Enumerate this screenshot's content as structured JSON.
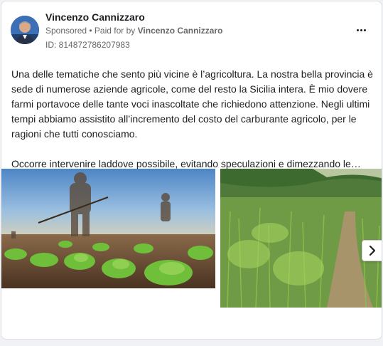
{
  "post": {
    "author": "Vincenzo Cannizzaro",
    "sponsored": "Sponsored",
    "separator": " • ",
    "paid_for_prefix": "Paid for by ",
    "paid_for_name": "Vincenzo Cannizzaro",
    "ad_id": "ID: 814872786207983",
    "paragraphs": [
      "Una delle tematiche che sento più vicine è l’agricoltura. La nostra bella provincia è sede di numerose aziende agricole, come del resto la Sicilia intera. È mio dovere farmi portavoce delle tante voci inascoltate che richiedono attenzione. Negli ultimi tempi abbiamo assistito all’incremento del costo del carburante agricolo, per le ragioni che tutti conosciamo.",
      "Occorre intervenire laddove possibile, evitando speculazioni e dimezzando le…"
    ]
  },
  "icons": {
    "more": "more-options-icon",
    "next": "chevron-right-icon"
  },
  "colors": {
    "text_primary": "#1c1e21",
    "text_secondary": "#65676b",
    "card_border": "#dddfe2"
  }
}
